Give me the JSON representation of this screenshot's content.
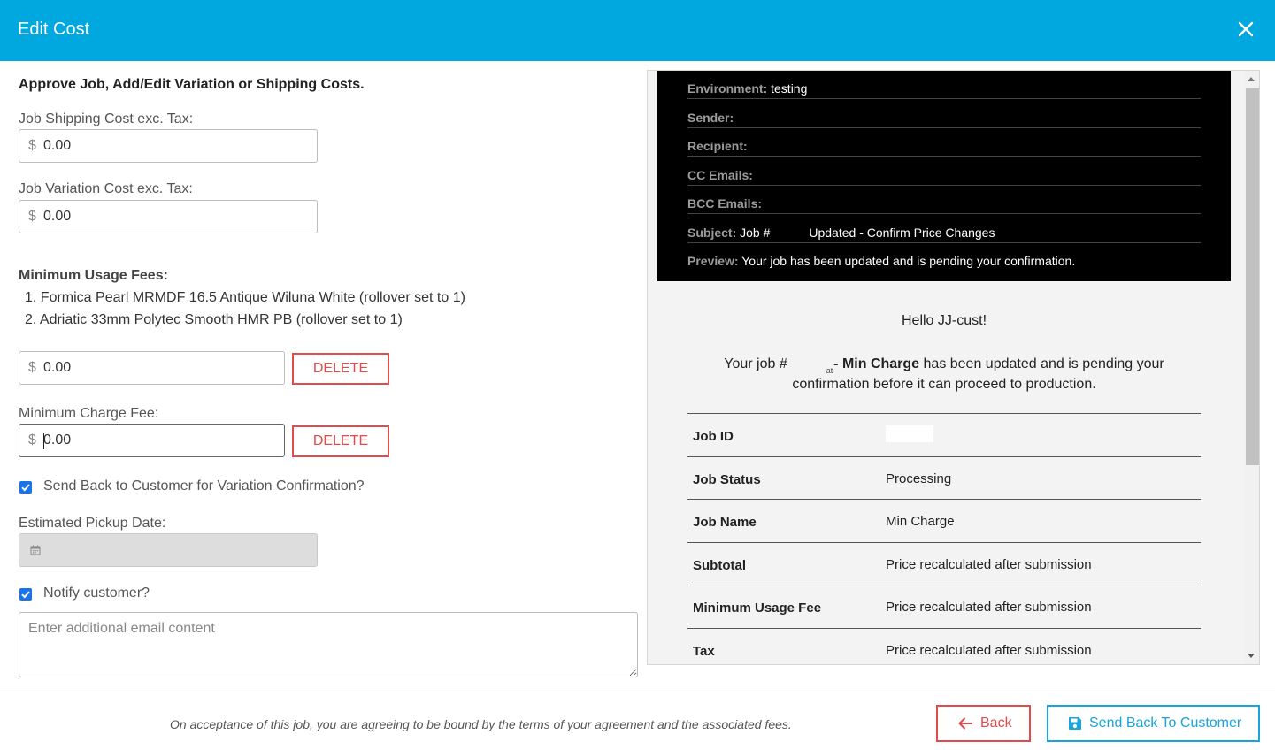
{
  "modal": {
    "title": "Edit Cost"
  },
  "form": {
    "heading": "Approve Job, Add/Edit Variation or Shipping Costs.",
    "currency_symbol": "$",
    "shipping": {
      "label": "Job Shipping Cost exc. Tax:",
      "value": "0.00"
    },
    "variation": {
      "label": "Job Variation Cost exc. Tax:",
      "value": "0.00"
    },
    "min_usage": {
      "title": "Minimum Usage Fees:",
      "items": [
        "1. Formica Pearl MRMDF 16.5 Antique Wiluna White (rollover set to 1)",
        "2. Adriatic 33mm Polytec Smooth HMR PB (rollover set to 1)"
      ],
      "value": "0.00",
      "delete_label": "DELETE"
    },
    "min_charge": {
      "label": "Minimum Charge Fee:",
      "value": "0.00",
      "delete_label": "DELETE"
    },
    "send_back_checkbox": {
      "label": "Send Back to Customer for Variation Confirmation?",
      "checked": true
    },
    "pickup": {
      "label": "Estimated Pickup Date:",
      "value": ""
    },
    "notify_checkbox": {
      "label": "Notify customer?",
      "checked": true
    },
    "email_content": {
      "placeholder": "Enter additional email content",
      "value": ""
    }
  },
  "email_preview": {
    "meta": [
      {
        "key": "Environment:",
        "value": "testing"
      },
      {
        "key": "Sender:",
        "value": ""
      },
      {
        "key": "Recipient:",
        "value": ""
      },
      {
        "key": "CC Emails:",
        "value": ""
      },
      {
        "key": "BCC Emails:",
        "value": ""
      },
      {
        "key": "Subject:",
        "value_pre": "Job #",
        "value_post": "Updated - Confirm Price Changes"
      },
      {
        "key": "Preview:",
        "value": "Your job has been updated and is pending your confirmation."
      }
    ],
    "greeting": "Hello JJ-cust!",
    "message": {
      "pre": "Your job #",
      "fragment": "at",
      "bold": "- Min Charge",
      "post": "has been updated and is pending your confirmation before it can proceed to production."
    },
    "table": [
      {
        "key": "Job ID",
        "value": ""
      },
      {
        "key": "Job Status",
        "value": "Processing"
      },
      {
        "key": "Job Name",
        "value": "Min Charge"
      },
      {
        "key": "Subtotal",
        "value": "Price recalculated after submission"
      },
      {
        "key": "Minimum Usage Fee",
        "value": "Price recalculated after submission"
      },
      {
        "key": "Tax",
        "value": "Price recalculated after submission"
      }
    ]
  },
  "footer": {
    "note": "On acceptance of this job, you are agreeing to be bound by the terms of your agreement and the associated fees.",
    "back_label": "Back",
    "send_label": "Send Back To Customer"
  },
  "colors": {
    "header_bg": "#01a7df",
    "danger": "#e04b4b",
    "primary": "#1aa3dc",
    "checkbox": "#1a73e8"
  },
  "icons": [
    "close-icon",
    "calendar-icon",
    "arrow-left-icon",
    "save-icon",
    "scroll-up-icon",
    "scroll-down-icon",
    "checkmark-icon"
  ]
}
